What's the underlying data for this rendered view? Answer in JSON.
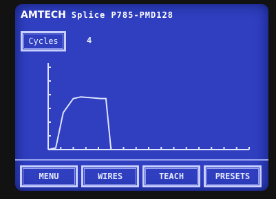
{
  "header": {
    "logo": "AMTECH",
    "model": "Splice P785-PMD128"
  },
  "cycles": {
    "label": "Cycles",
    "value": "4"
  },
  "graph": {
    "trace": [
      [
        0.0,
        0.0
      ],
      [
        0.6,
        0.02
      ],
      [
        1.2,
        0.45
      ],
      [
        2.0,
        0.62
      ],
      [
        2.6,
        0.64
      ],
      [
        3.4,
        0.63
      ],
      [
        4.2,
        0.62
      ],
      [
        4.6,
        0.62
      ],
      [
        5.0,
        0.0
      ],
      [
        16.0,
        0.0
      ]
    ],
    "x_ticks": 16,
    "y_ticks": 6
  },
  "nav": {
    "menu": "MENU",
    "wires": "WIRES",
    "teach": "TEACH",
    "presets": "PRESETS"
  },
  "colors": {
    "screen_bg": "#2f3fc0",
    "foreground": "#e6eaff"
  }
}
